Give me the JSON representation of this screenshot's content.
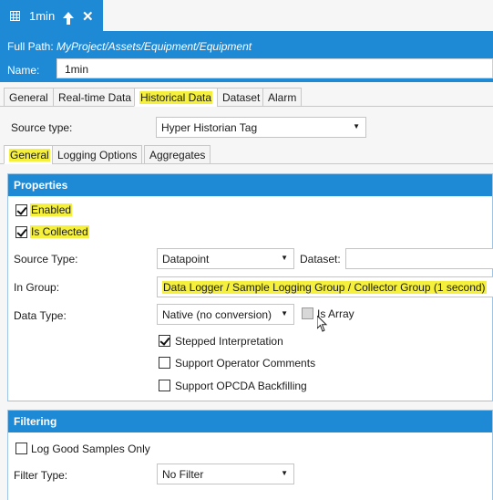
{
  "doc_tab": {
    "title": "1min",
    "icons": [
      "grid-icon",
      "pin-icon",
      "close-icon"
    ]
  },
  "header": {
    "path_label": "Full Path:",
    "path_value": "MyProject/Assets/Equipment/Equipment",
    "name_label": "Name:",
    "name_value": "1min"
  },
  "main_tabs": [
    {
      "label": "General"
    },
    {
      "label": "Real-time Data"
    },
    {
      "label": "Historical Data"
    },
    {
      "label": "Dataset"
    },
    {
      "label": "Alarm"
    }
  ],
  "source_type": {
    "label": "Source type:",
    "value": "Hyper Historian Tag"
  },
  "sub_tabs": [
    {
      "label": "General"
    },
    {
      "label": "Logging Options"
    },
    {
      "label": "Aggregates"
    }
  ],
  "properties": {
    "title": "Properties",
    "enabled": {
      "label": "Enabled",
      "checked": true
    },
    "is_collected": {
      "label": "Is Collected",
      "checked": true
    },
    "source_type": {
      "label": "Source Type:",
      "value": "Datapoint"
    },
    "dataset_label": "Dataset:",
    "dataset_value": "",
    "in_group": {
      "label": "In Group:",
      "value": "Data Logger / Sample Logging Group / Collector Group (1 second)"
    },
    "data_type": {
      "label": "Data Type:",
      "value": "Native (no conversion)"
    },
    "is_array": {
      "label": "Is Array",
      "checked": false
    },
    "stepped": {
      "label": "Stepped Interpretation",
      "checked": true
    },
    "operator_comments": {
      "label": "Support Operator Comments",
      "checked": false
    },
    "opcda_backfilling": {
      "label": "Support OPCDA Backfilling",
      "checked": false
    }
  },
  "filtering": {
    "title": "Filtering",
    "log_good": {
      "label": "Log Good Samples Only",
      "checked": false
    },
    "filter_type": {
      "label": "Filter Type:",
      "value": "No Filter"
    }
  },
  "colors": {
    "accent": "#1e8ad6",
    "highlight": "#f5f03c"
  }
}
